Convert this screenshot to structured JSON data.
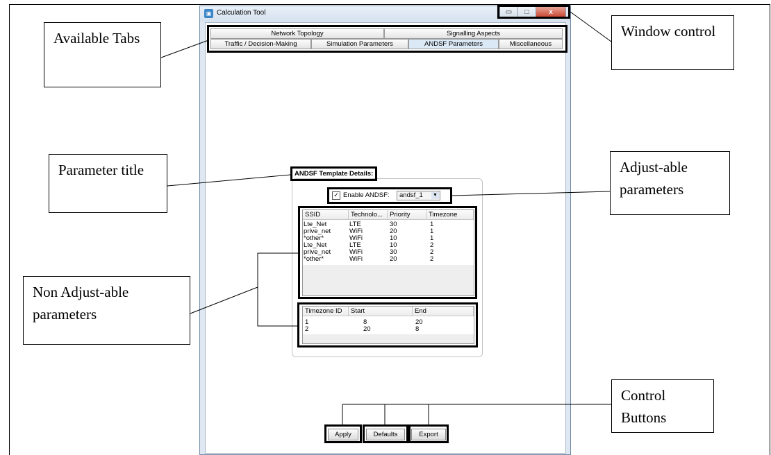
{
  "window": {
    "title": "Calculation Tool",
    "controls": {
      "minimize": "▭",
      "maximize": "□",
      "close": "x"
    }
  },
  "tabs": {
    "row1": [
      "Network Topology",
      "Signalling Aspects"
    ],
    "row2": [
      "Traffic / Decision-Making",
      "Simulation Parameters",
      "ANDSF Parameters",
      "Miscellaneous"
    ],
    "active": "ANDSF Parameters"
  },
  "group": {
    "title": "ANDSF Template Details:",
    "enable_label": "Enable ANDSF:",
    "enable_checked": true,
    "select_value": "andsf_1"
  },
  "policy_table": {
    "columns": [
      "SSID",
      "Technolo...",
      "Priority",
      "Timezone"
    ],
    "rows": [
      [
        "Lte_Net",
        "LTE",
        "30",
        "1"
      ],
      [
        "prive_net",
        "WiFi",
        "20",
        "1"
      ],
      [
        "*other*",
        "WiFi",
        "10",
        "1"
      ],
      [
        "Lte_Net",
        "LTE",
        "10",
        "2"
      ],
      [
        "prive_net",
        "WiFi",
        "30",
        "2"
      ],
      [
        "*other*",
        "WiFi",
        "20",
        "2"
      ]
    ]
  },
  "timezone_table": {
    "columns": [
      "Timezone ID",
      "Start",
      "End"
    ],
    "rows": [
      [
        "1",
        "8",
        "20"
      ],
      [
        "2",
        "20",
        "8"
      ]
    ]
  },
  "buttons": {
    "apply": "Apply",
    "defaults": "Defaults",
    "export": "Export"
  },
  "callouts": {
    "available_tabs": "Available Tabs",
    "window_control": "Window control",
    "parameter_title": "Parameter title",
    "adjustable": "Adjust-able parameters",
    "non_adjustable": "Non  Adjust-able parameters",
    "control_buttons": "Control Buttons"
  }
}
